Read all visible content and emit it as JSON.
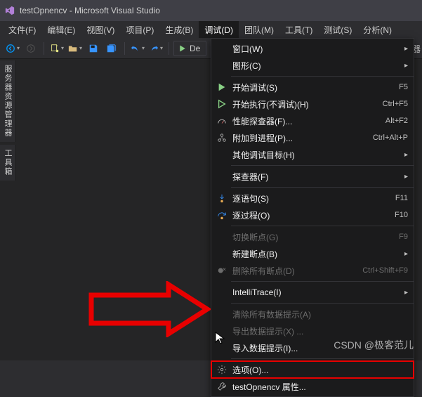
{
  "title": "testOpnencv - Microsoft Visual Studio",
  "menubar": {
    "items": [
      {
        "label": "文件(F)"
      },
      {
        "label": "编辑(E)"
      },
      {
        "label": "视图(V)"
      },
      {
        "label": "项目(P)"
      },
      {
        "label": "生成(B)"
      },
      {
        "label": "调试(D)",
        "active": true
      },
      {
        "label": "团队(M)"
      },
      {
        "label": "工具(T)"
      },
      {
        "label": "测试(S)"
      },
      {
        "label": "分析(N)"
      }
    ]
  },
  "toolbar": {
    "debug_label": "De",
    "right_cut": "试器"
  },
  "left_tabs": {
    "items": [
      {
        "label": "服务器资源管理器"
      },
      {
        "label": "工具箱"
      }
    ]
  },
  "debug_menu": {
    "items": [
      {
        "icon": "",
        "label": "窗口(W)",
        "sub": true
      },
      {
        "icon": "",
        "label": "图形(C)",
        "sub": true
      },
      {
        "sep": true
      },
      {
        "icon": "play-green",
        "label": "开始调试(S)",
        "shortcut": "F5"
      },
      {
        "icon": "play-outline",
        "label": "开始执行(不调试)(H)",
        "shortcut": "Ctrl+F5"
      },
      {
        "icon": "perf",
        "label": "性能探查器(F)...",
        "shortcut": "Alt+F2"
      },
      {
        "icon": "attach",
        "label": "附加到进程(P)...",
        "shortcut": "Ctrl+Alt+P"
      },
      {
        "icon": "",
        "label": "其他调试目标(H)",
        "sub": true
      },
      {
        "sep": true
      },
      {
        "icon": "",
        "label": "探查器(F)",
        "sub": true
      },
      {
        "sep": true
      },
      {
        "icon": "step-into",
        "label": "逐语句(S)",
        "shortcut": "F11"
      },
      {
        "icon": "step-over",
        "label": "逐过程(O)",
        "shortcut": "F10"
      },
      {
        "sep": true
      },
      {
        "icon": "",
        "label": "切换断点(G)",
        "shortcut": "F9",
        "disabled": true
      },
      {
        "icon": "",
        "label": "新建断点(B)",
        "sub": true
      },
      {
        "icon": "del-bp",
        "label": "删除所有断点(D)",
        "shortcut": "Ctrl+Shift+F9",
        "disabled": true
      },
      {
        "sep": true
      },
      {
        "icon": "",
        "label": "IntelliTrace(I)",
        "sub": true
      },
      {
        "sep": true
      },
      {
        "icon": "",
        "label": "清除所有数据提示(A)",
        "disabled": true
      },
      {
        "icon": "",
        "label": "导出数据提示(X) ...",
        "disabled": true
      },
      {
        "icon": "",
        "label": "导入数据提示(I)..."
      },
      {
        "sep": true
      },
      {
        "icon": "gear",
        "label": "选项(O)...",
        "highlight": true
      },
      {
        "icon": "wrench",
        "label": "testOpnencv 属性..."
      }
    ]
  },
  "watermark": "CSDN @极客范儿"
}
